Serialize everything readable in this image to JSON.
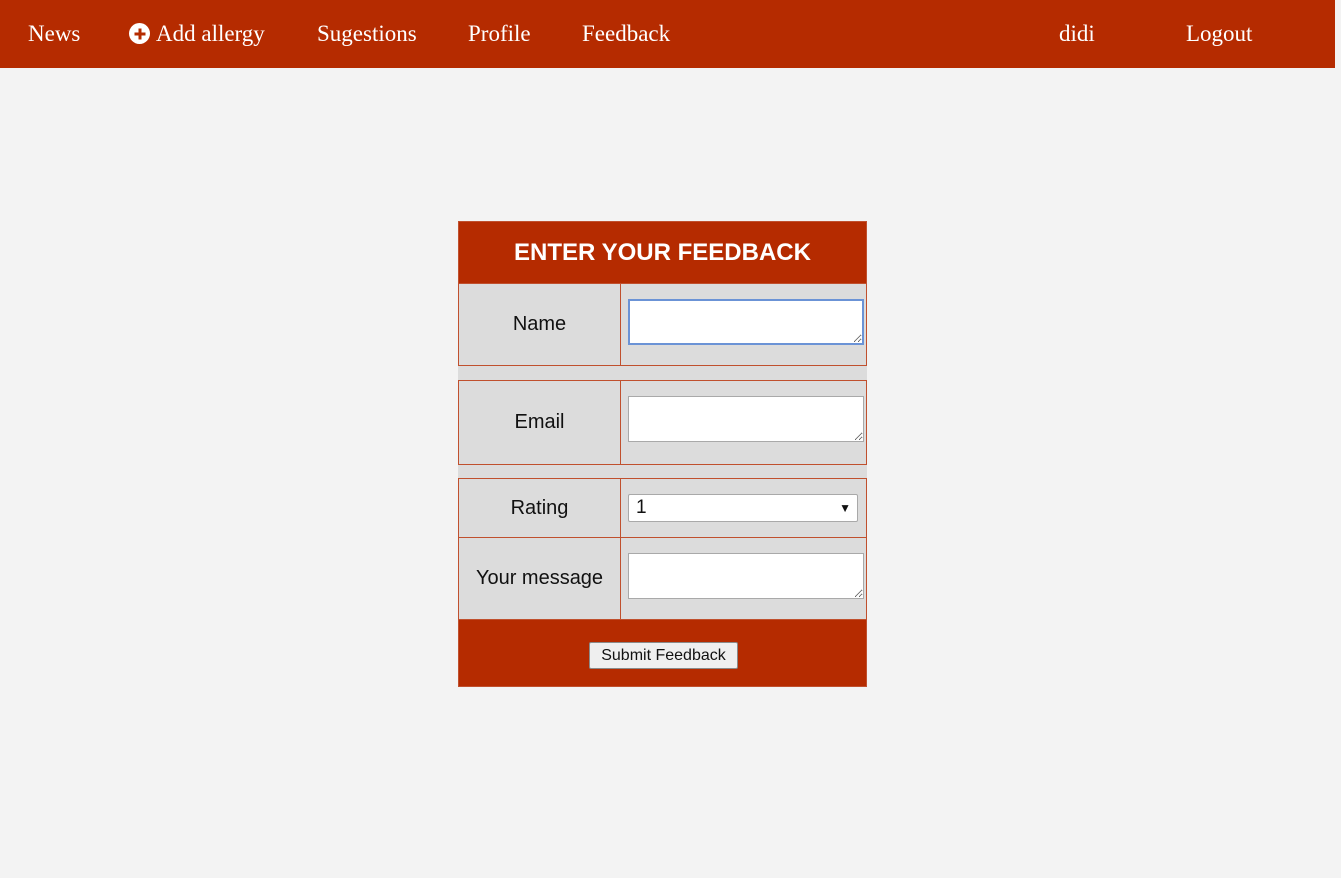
{
  "nav": {
    "news": "News",
    "add_allergy": "Add allergy",
    "add_allergy_icon": "plus-circle-icon",
    "suggestions": "Sugestions",
    "profile": "Profile",
    "feedback": "Feedback",
    "user": "didi",
    "logout": "Logout"
  },
  "form": {
    "title": "ENTER YOUR FEEDBACK",
    "name_label": "Name",
    "name_value": "",
    "email_label": "Email",
    "email_value": "",
    "rating_label": "Rating",
    "rating_value": "1",
    "message_label": "Your message",
    "message_value": "",
    "submit_label": "Submit Feedback"
  },
  "colors": {
    "accent": "#b52b00",
    "background": "#f3f3f3",
    "form_cell": "#dcdcdc"
  }
}
